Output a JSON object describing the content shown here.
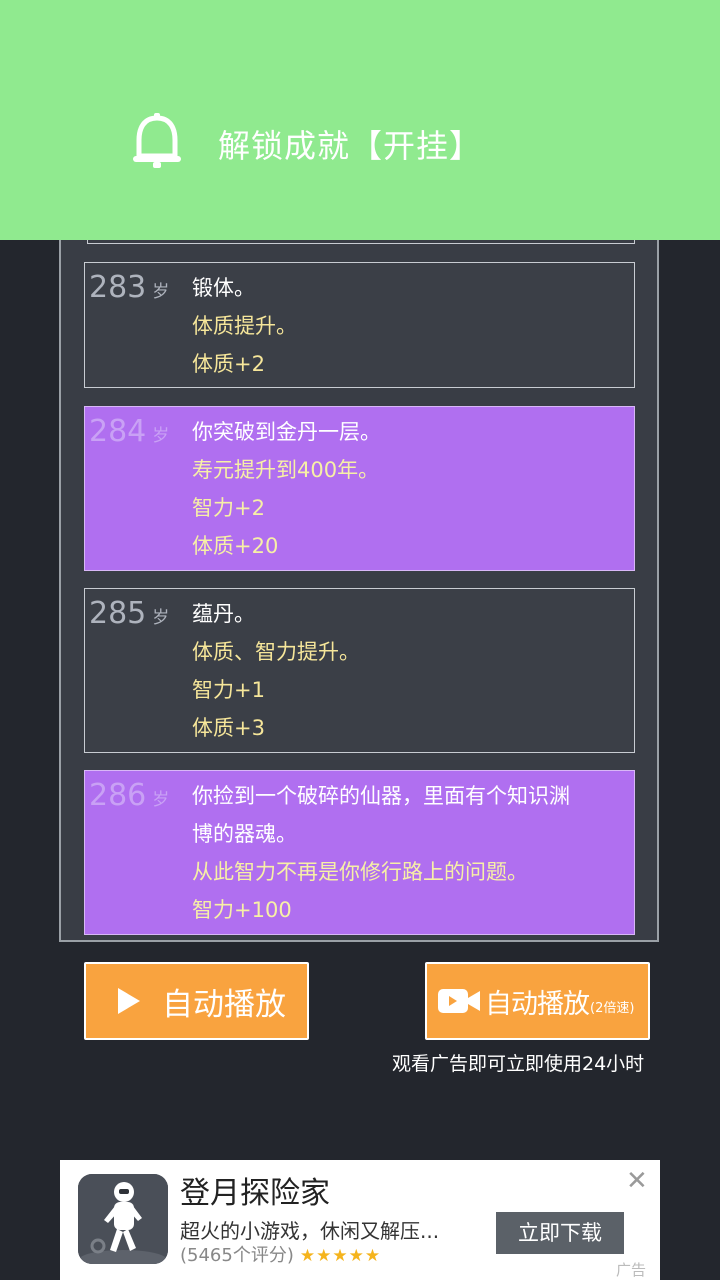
{
  "notification": {
    "icon": "bell-icon",
    "text": "解锁成就【开挂】",
    "bg_color": "#90ea8f"
  },
  "log": {
    "entries": [
      {
        "age": "283",
        "unit": "岁",
        "style": "gray",
        "lines": [
          {
            "text": "锻体。",
            "hl": false
          },
          {
            "text": "体质提升。",
            "hl": true
          },
          {
            "text": "体质+2",
            "hl": true
          }
        ]
      },
      {
        "age": "284",
        "unit": "岁",
        "style": "purple",
        "lines": [
          {
            "text": "你突破到金丹一层。",
            "hl": false
          },
          {
            "text": "寿元提升到400年。",
            "hl": true
          },
          {
            "text": "智力+2",
            "hl": true
          },
          {
            "text": "体质+20",
            "hl": true
          }
        ]
      },
      {
        "age": "285",
        "unit": "岁",
        "style": "gray",
        "lines": [
          {
            "text": "蕴丹。",
            "hl": false
          },
          {
            "text": "体质、智力提升。",
            "hl": true
          },
          {
            "text": "智力+1",
            "hl": true
          },
          {
            "text": "体质+3",
            "hl": true
          }
        ]
      },
      {
        "age": "286",
        "unit": "岁",
        "style": "purple",
        "lines": [
          {
            "text": "你捡到一个破碎的仙器，里面有个知识渊",
            "hl": false
          },
          {
            "text": "博的器魂。",
            "hl": false
          },
          {
            "text": "从此智力不再是你修行路上的问题。",
            "hl": true
          },
          {
            "text": "智力+100",
            "hl": true
          }
        ]
      }
    ]
  },
  "buttons": {
    "autoplay": {
      "label": "自动播放",
      "icon": "play-icon"
    },
    "autoplay_fast": {
      "label": "自动播放",
      "suffix": "(2倍速)",
      "icon": "video-camera-icon"
    },
    "color": "#f9a33f"
  },
  "hint": "观看广告即可立即使用24小时",
  "ad": {
    "title": "登月探险家",
    "description": "超火的小游戏，休闲又解压...",
    "rating": "(5465个评分)",
    "stars": "★★★★★",
    "cta": "立即下载",
    "label": "广告",
    "close": "✕"
  }
}
